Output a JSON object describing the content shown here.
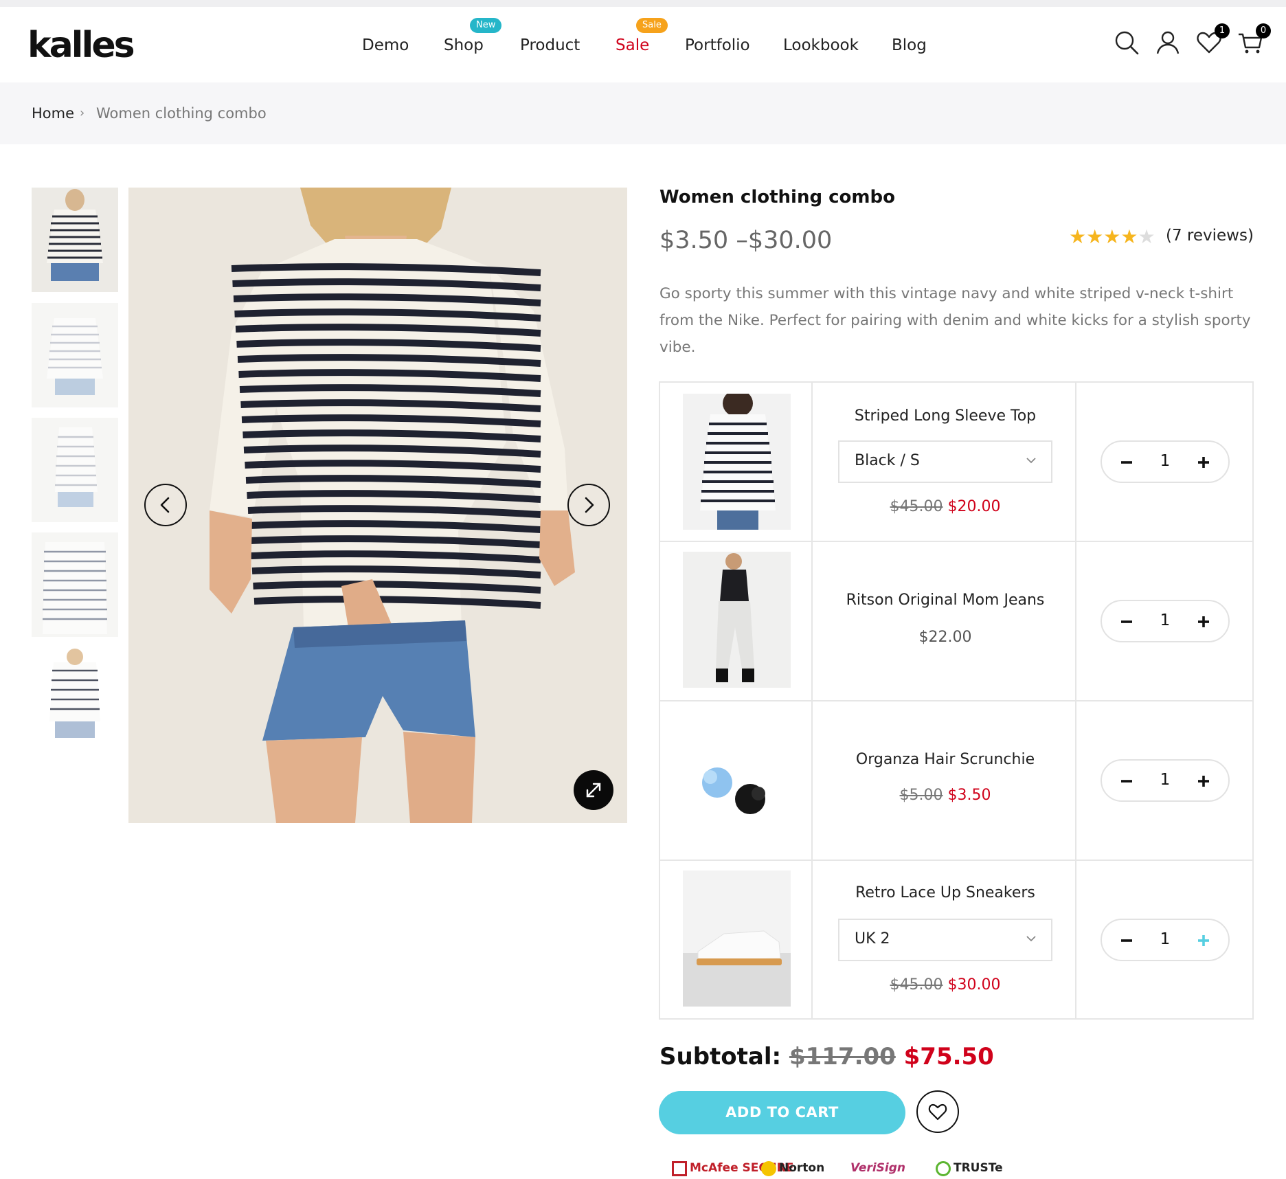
{
  "header": {
    "logo": "kalles",
    "nav": [
      {
        "label": "Demo"
      },
      {
        "label": "Shop",
        "badge": "New"
      },
      {
        "label": "Product"
      },
      {
        "label": "Sale",
        "badge": "Sale"
      },
      {
        "label": "Portfolio"
      },
      {
        "label": "Lookbook"
      },
      {
        "label": "Blog"
      }
    ],
    "wishlist_count": "1",
    "cart_count": "0",
    "icons": [
      "search-icon",
      "account-icon",
      "heart-icon",
      "cart-icon"
    ]
  },
  "breadcrumb": {
    "home": "Home",
    "separator": "›",
    "current": "Women clothing combo"
  },
  "gallery": {
    "thumbnails": [
      "striped-top-front",
      "striped-top-light",
      "striped-top-side",
      "striped-top-flat",
      "striped-top-back"
    ],
    "main_image": "woman in striped long sleeve top and denim shorts"
  },
  "product": {
    "title": "Women clothing combo",
    "price_range": "$3.50 –$30.00",
    "rating": 4,
    "rating_max": 5,
    "reviews": "(7 reviews)",
    "description": "Go sporty this summer with this vintage navy and white striped v-neck t-shirt from the Nike. Perfect for pairing with denim and white kicks for a stylish sporty vibe."
  },
  "combo": {
    "items": [
      {
        "name": "Striped Long Sleeve Top",
        "variant": "Black / S",
        "old_price": "$45.00",
        "price": "$20.00",
        "qty": "1"
      },
      {
        "name": "Ritson Original Mom Jeans",
        "price": "$22.00",
        "qty": "1"
      },
      {
        "name": "Organza Hair Scrunchie",
        "old_price": "$5.00",
        "price": "$3.50",
        "qty": "1"
      },
      {
        "name": "Retro Lace Up Sneakers",
        "variant": "UK 2",
        "old_price": "$45.00",
        "price": "$30.00",
        "qty": "1"
      }
    ]
  },
  "subtotal": {
    "label": "Subtotal:",
    "old": "$117.00",
    "new": "$75.50"
  },
  "actions": {
    "add_to_cart": "ADD TO CART"
  },
  "trust_badges": [
    "McAfee SECURE",
    "Norton",
    "VeriSign",
    "TRUSTe"
  ],
  "colors": {
    "accent": "#56cfe1",
    "sale_red": "#d0021b",
    "badge_new": "#25b6c9",
    "badge_sale": "#f6a21b",
    "star": "#f6b51e"
  }
}
